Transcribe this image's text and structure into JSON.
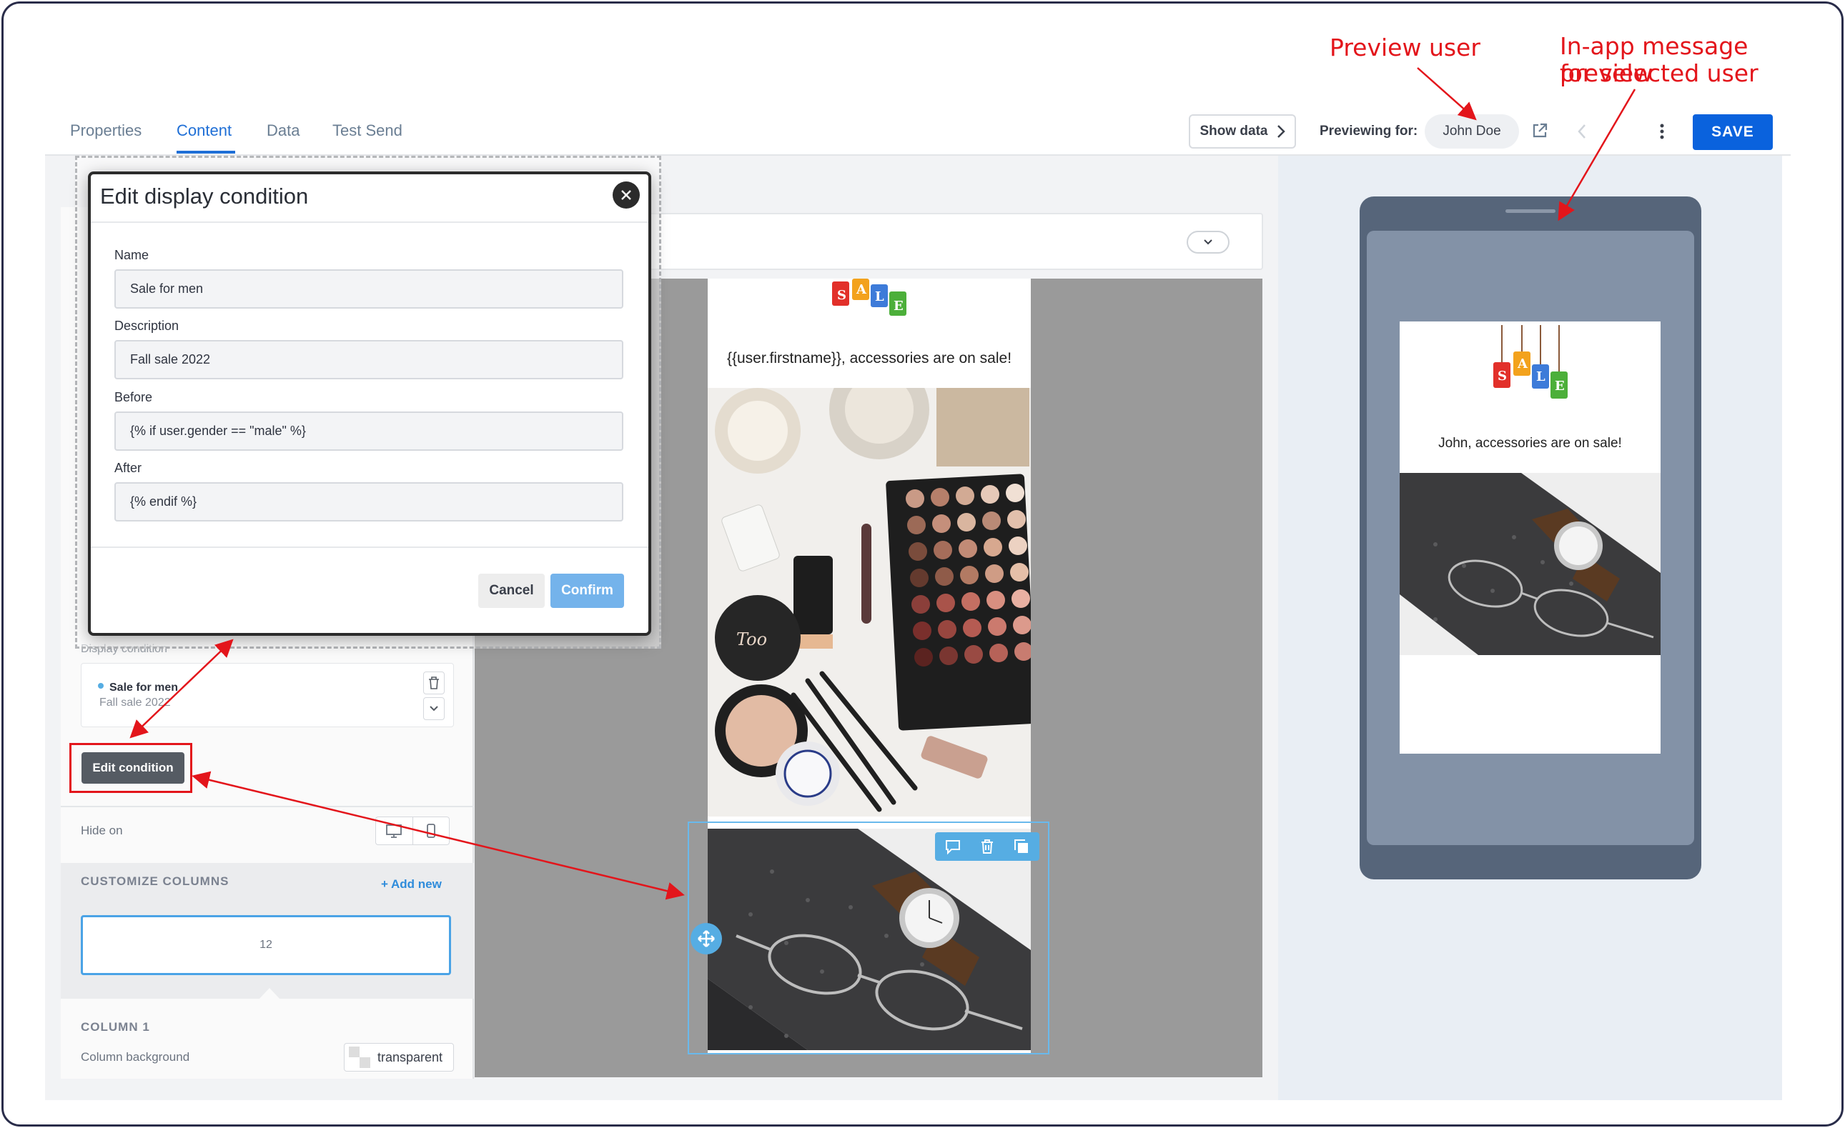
{
  "annotations": {
    "preview_user": "Preview user",
    "in_app_line1": "In-app message preview",
    "in_app_line2": "for selected user"
  },
  "tabs": [
    {
      "label": "Properties"
    },
    {
      "label": "Content"
    },
    {
      "label": "Data"
    },
    {
      "label": "Test Send"
    }
  ],
  "toolbar": {
    "show_data": "Show data",
    "previewing_for": "Previewing for:",
    "user": "John Doe",
    "save": "SAVE"
  },
  "modal": {
    "title": "Edit display condition",
    "name_label": "Name",
    "name_value": "Sale for men",
    "description_label": "Description",
    "description_value": "Fall sale 2022",
    "before_label": "Before",
    "before_value": "{% if user.gender == \"male\" %}",
    "after_label": "After",
    "after_value": "{% endif %}",
    "cancel": "Cancel",
    "confirm": "Confirm"
  },
  "left_panel": {
    "display_condition_label": "Display condition",
    "condition_name": "Sale for men",
    "condition_desc": "Fall sale 2022",
    "edit_condition": "Edit condition",
    "hide_on": "Hide on",
    "customize_columns": "CUSTOMIZE COLUMNS",
    "add_new": "+ Add new",
    "column_width": "12",
    "column1": "COLUMN 1",
    "column_background": "Column background",
    "transparent": "transparent"
  },
  "email": {
    "headline": "{{user.firstname}}, accessories are on sale!"
  },
  "preview": {
    "headline": "John, accessories are on sale!"
  },
  "sale_letters": [
    "S",
    "A",
    "L",
    "E"
  ],
  "colors": {
    "accent": "#0a62dd",
    "annotation": "#e3151b",
    "tag_red": "#e2302a",
    "tag_orange": "#f3a21d",
    "tag_blue": "#3d7bd9",
    "tag_green": "#4caf3a"
  }
}
